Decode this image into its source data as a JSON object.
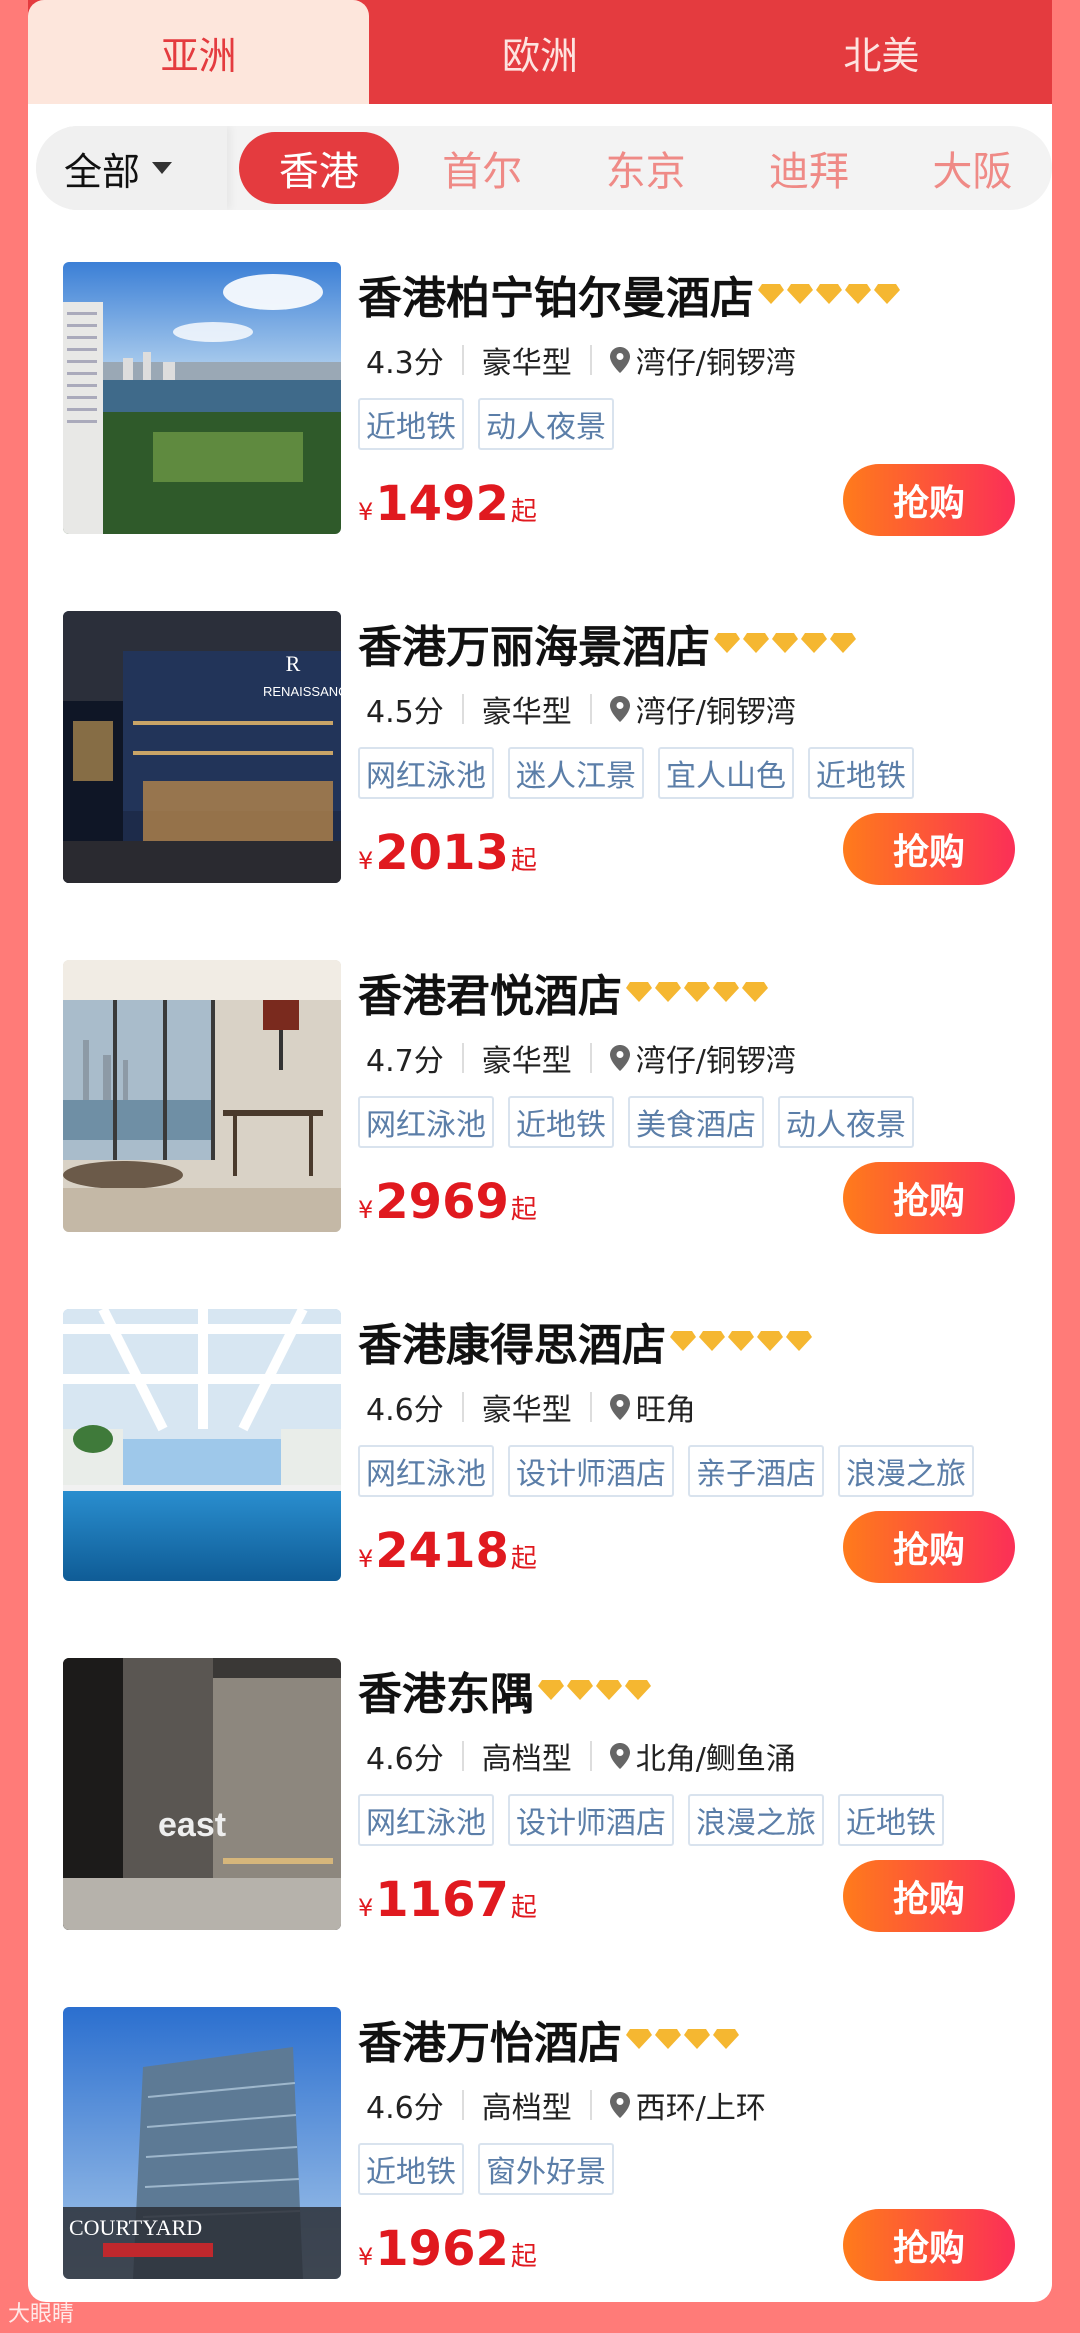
{
  "region_tabs": [
    {
      "label": "亚洲",
      "active": true
    },
    {
      "label": "欧洲",
      "active": false
    },
    {
      "label": "北美",
      "active": false
    }
  ],
  "filter": {
    "label": "全部"
  },
  "cities": [
    {
      "label": "香港",
      "active": true
    },
    {
      "label": "首尔",
      "active": false
    },
    {
      "label": "东京",
      "active": false
    },
    {
      "label": "迪拜",
      "active": false
    },
    {
      "label": "大阪",
      "active": false
    }
  ],
  "hotels": [
    {
      "name": "香港柏宁铂尔曼酒店",
      "diamonds": 5,
      "score": "4.3分",
      "type": "豪华型",
      "location": "湾仔/铜锣湾",
      "tags": [
        "近地铁",
        "动人夜景"
      ],
      "currency": "¥",
      "price": "1492",
      "price_suffix": "起",
      "buy_label": "抢购"
    },
    {
      "name": "香港万丽海景酒店",
      "diamonds": 5,
      "score": "4.5分",
      "type": "豪华型",
      "location": "湾仔/铜锣湾",
      "tags": [
        "网红泳池",
        "迷人江景",
        "宜人山色",
        "近地铁"
      ],
      "currency": "¥",
      "price": "2013",
      "price_suffix": "起",
      "buy_label": "抢购"
    },
    {
      "name": "香港君悦酒店",
      "diamonds": 5,
      "score": "4.7分",
      "type": "豪华型",
      "location": "湾仔/铜锣湾",
      "tags": [
        "网红泳池",
        "近地铁",
        "美食酒店",
        "动人夜景"
      ],
      "currency": "¥",
      "price": "2969",
      "price_suffix": "起",
      "buy_label": "抢购"
    },
    {
      "name": "香港康得思酒店",
      "diamonds": 5,
      "score": "4.6分",
      "type": "豪华型",
      "location": "旺角",
      "tags": [
        "网红泳池",
        "设计师酒店",
        "亲子酒店",
        "浪漫之旅"
      ],
      "currency": "¥",
      "price": "2418",
      "price_suffix": "起",
      "buy_label": "抢购"
    },
    {
      "name": "香港东隅",
      "diamonds": 4,
      "score": "4.6分",
      "type": "高档型",
      "location": "北角/鲗鱼涌",
      "tags": [
        "网红泳池",
        "设计师酒店",
        "浪漫之旅",
        "近地铁"
      ],
      "currency": "¥",
      "price": "1167",
      "price_suffix": "起",
      "buy_label": "抢购"
    },
    {
      "name": "香港万怡酒店",
      "diamonds": 4,
      "score": "4.6分",
      "type": "高档型",
      "location": "西环/上环",
      "tags": [
        "近地铁",
        "窗外好景"
      ],
      "currency": "¥",
      "price": "1962",
      "price_suffix": "起",
      "buy_label": "抢购"
    }
  ],
  "photos": [
    {
      "sign": ""
    },
    {
      "sign": "RENAISSANCE"
    },
    {
      "sign": ""
    },
    {
      "sign": ""
    },
    {
      "sign": "east"
    },
    {
      "sign": "COURTYARD"
    }
  ],
  "colors": {
    "accent": "#e43b3f",
    "price": "#e0191f",
    "diamond": "#f5b731",
    "background": "#ff7b78"
  },
  "watermark": "大眼睛"
}
